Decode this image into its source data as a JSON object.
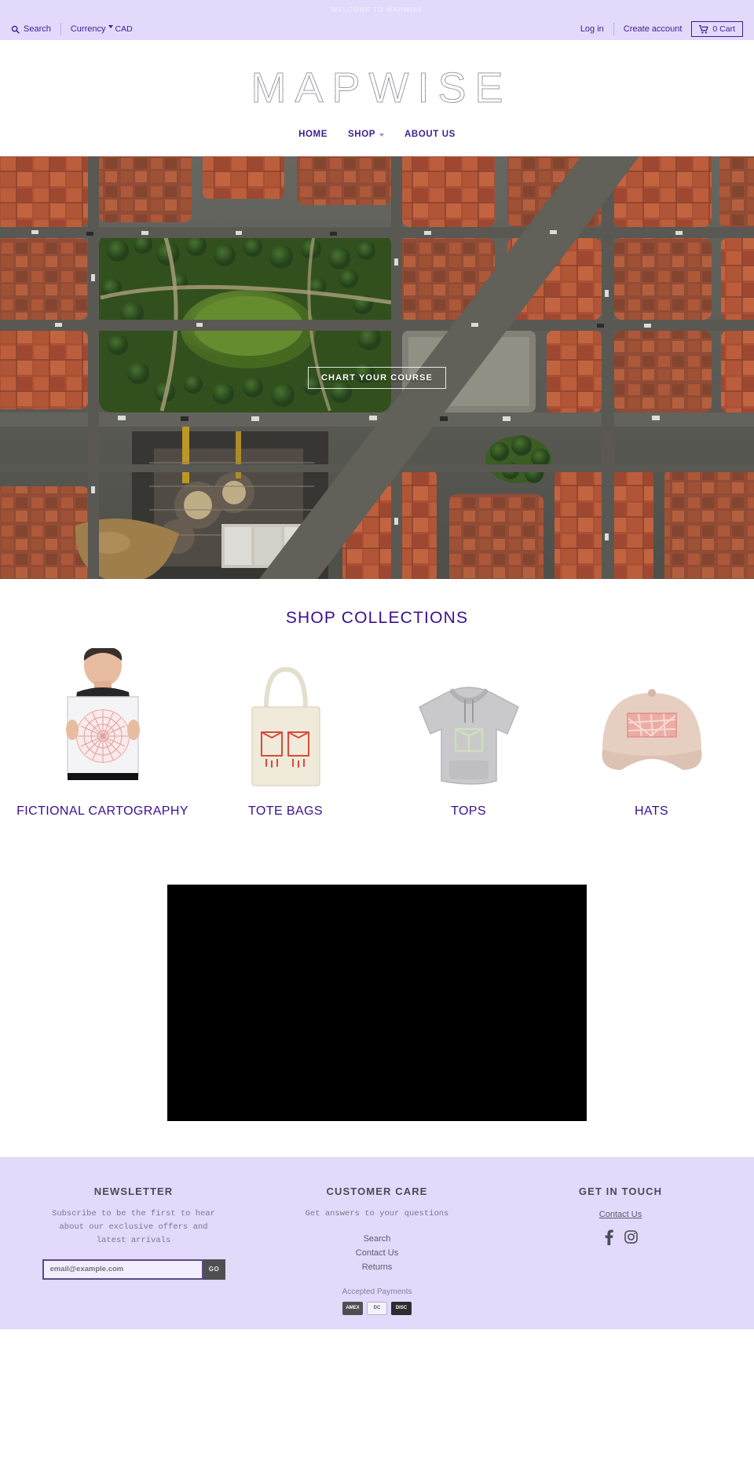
{
  "announcement": {
    "text": "WELCOME TO MAPWISE"
  },
  "topbar": {
    "search_label": "Search",
    "currency_label": "Currency",
    "currency_value": "CAD",
    "login_label": "Log in",
    "create_account_label": "Create account",
    "cart_label": "0 Cart"
  },
  "header": {
    "logo": "MAPWISE",
    "nav": [
      {
        "label": "HOME",
        "has_dropdown": false
      },
      {
        "label": "SHOP",
        "has_dropdown": true
      },
      {
        "label": "ABOUT US",
        "has_dropdown": false
      }
    ]
  },
  "hero": {
    "cta_label": "CHART YOUR COURSE",
    "alt": "aerial satellite view of a dense city block with a green park, orange tile rooftops and a large cathedral construction site"
  },
  "collections": {
    "title": "SHOP COLLECTIONS",
    "items": [
      {
        "label": "FICTIONAL CARTOGRAPHY",
        "icon": "framed-map-print"
      },
      {
        "label": "TOTE BAGS",
        "icon": "tote-bag"
      },
      {
        "label": "TOPS",
        "icon": "hoodie"
      },
      {
        "label": "HATS",
        "icon": "baseball-cap"
      }
    ]
  },
  "video": {
    "state": "black-player"
  },
  "footer": {
    "newsletter": {
      "title": "NEWSLETTER",
      "subtitle": "Subscribe to be the first to hear about our exclusive offers and latest arrivals",
      "email_placeholder": "email@example.com",
      "submit_label": "GO"
    },
    "customer_care": {
      "title": "CUSTOMER CARE",
      "subtitle": "Get answers to your questions",
      "links": [
        "Search",
        "Contact Us",
        "Returns"
      ],
      "accepted_label": "Accepted Payments",
      "payments": [
        "amex",
        "diners",
        "discover"
      ]
    },
    "get_in_touch": {
      "title": "GET IN TOUCH",
      "contact_label": "Contact Us",
      "socials": [
        "facebook-icon",
        "instagram-icon"
      ]
    }
  },
  "colors": {
    "lavender": "#e2d9fb",
    "purple": "#3f1f8f",
    "heading_purple": "#3a0f8f",
    "footer_text": "#5c5c6b"
  }
}
